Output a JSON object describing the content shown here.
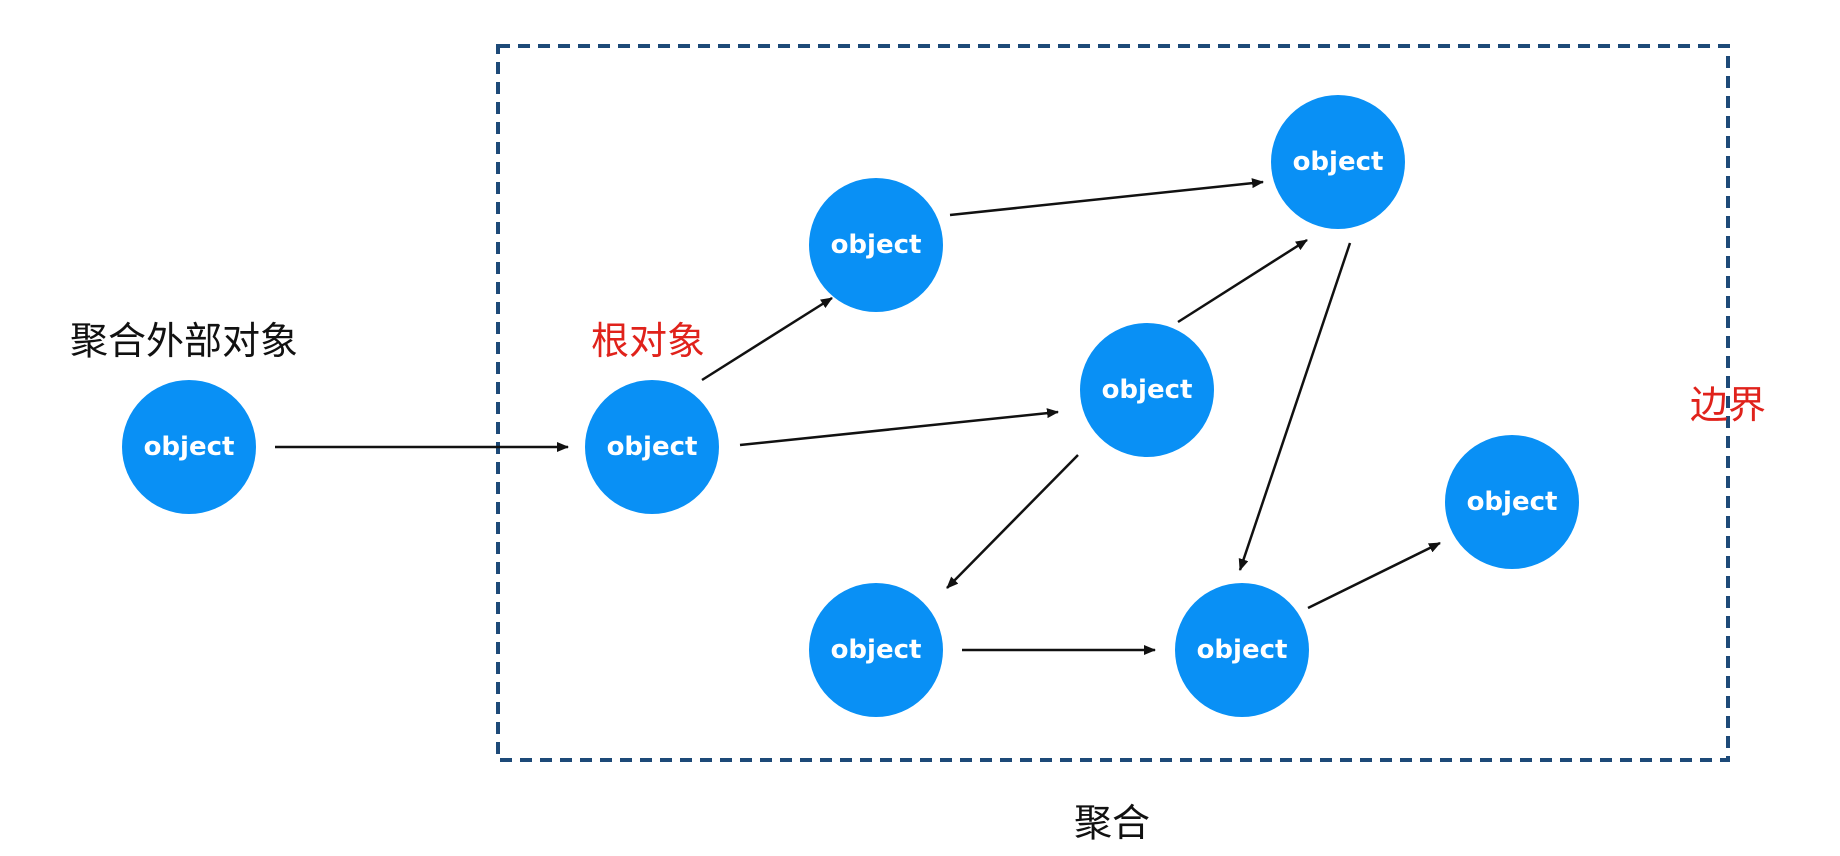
{
  "diagram": {
    "outside_label": "聚合外部对象",
    "root_label": "根对象",
    "boundary_label": "边界",
    "aggregate_label": "聚合",
    "node_text": "object",
    "colors": {
      "node": "#0990f5",
      "node_text": "#ffffff",
      "highlight_text": "#e0221b",
      "plain_text": "#111111",
      "boundary": "#1d4a78",
      "edge": "#111111"
    },
    "nodes": [
      {
        "id": "external"
      },
      {
        "id": "root"
      },
      {
        "id": "upper-left"
      },
      {
        "id": "top-right"
      },
      {
        "id": "center"
      },
      {
        "id": "lower-left"
      },
      {
        "id": "lower-middle"
      },
      {
        "id": "lower-right"
      }
    ],
    "edges": [
      {
        "from": "external",
        "to": "root"
      },
      {
        "from": "root",
        "to": "upper-left"
      },
      {
        "from": "root",
        "to": "center"
      },
      {
        "from": "upper-left",
        "to": "top-right"
      },
      {
        "from": "center",
        "to": "top-right"
      },
      {
        "from": "top-right",
        "to": "lower-middle"
      },
      {
        "from": "center",
        "to": "lower-left"
      },
      {
        "from": "lower-left",
        "to": "lower-middle"
      },
      {
        "from": "lower-middle",
        "to": "lower-right"
      }
    ]
  }
}
